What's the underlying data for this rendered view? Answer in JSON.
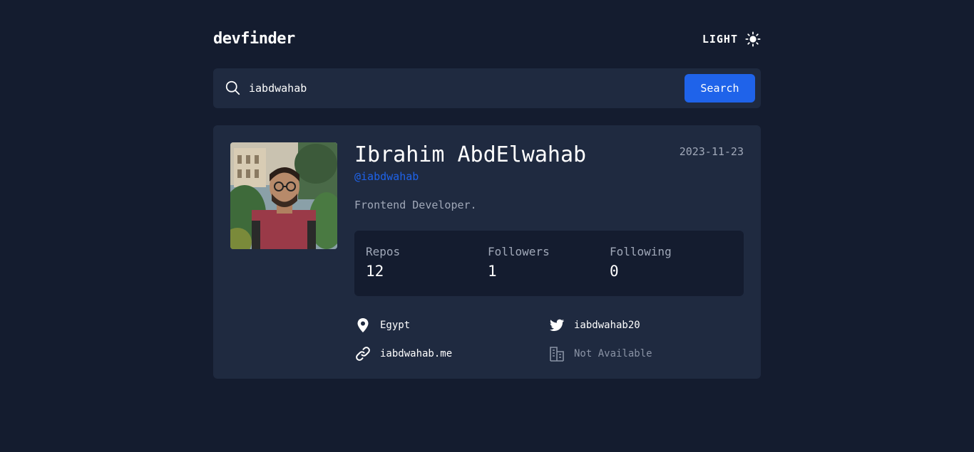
{
  "app": {
    "logo": "devfinder",
    "theme_toggle_label": "LIGHT"
  },
  "search": {
    "value": "iabdwahab",
    "placeholder": "",
    "button_label": "Search"
  },
  "profile": {
    "name": "Ibrahim AbdElwahab",
    "login": "@iabdwahab",
    "joined": "2023-11-23",
    "bio": "Frontend Developer.",
    "stats": [
      {
        "label": "Repos",
        "value": "12"
      },
      {
        "label": "Followers",
        "value": "1"
      },
      {
        "label": "Following",
        "value": "0"
      }
    ],
    "links": {
      "location": "Egypt",
      "twitter": "iabdwahab20",
      "blog": "iabdwahab.me",
      "company": "Not Available"
    }
  },
  "colors": {
    "background": "#141c2f",
    "card": "#1f2a40",
    "accent": "#1f63ea",
    "muted_text": "#a0a8b8"
  },
  "icons": {
    "theme": "sun-icon",
    "search": "search-icon",
    "location": "location-pin-icon",
    "twitter": "twitter-icon",
    "blog": "link-icon",
    "company": "building-icon"
  }
}
